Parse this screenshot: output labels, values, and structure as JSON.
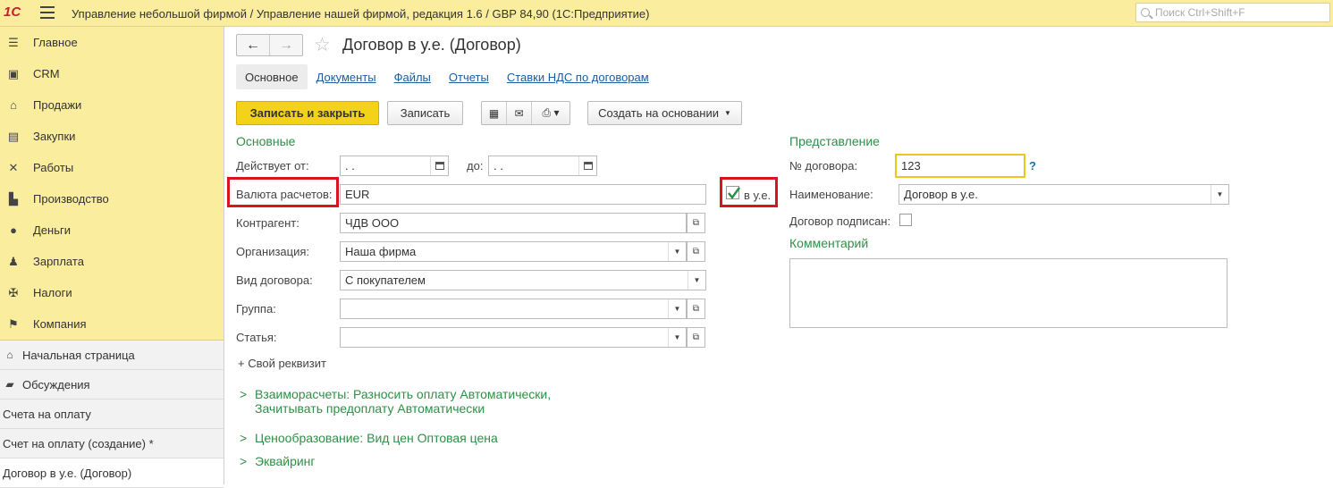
{
  "app": {
    "logo": "1С",
    "title": "Управление небольшой фирмой / Управление нашей фирмой, редакция 1.6 / GBP 84,90   (1С:Предприятие)",
    "search_placeholder": "Поиск Ctrl+Shift+F"
  },
  "sidebar": {
    "sections": [
      {
        "label": "Главное",
        "icon": "menu-icon"
      },
      {
        "label": "CRM",
        "icon": "contacts-icon"
      },
      {
        "label": "Продажи",
        "icon": "basket-icon"
      },
      {
        "label": "Закупки",
        "icon": "cart-icon"
      },
      {
        "label": "Работы",
        "icon": "tools-icon"
      },
      {
        "label": "Производство",
        "icon": "factory-icon"
      },
      {
        "label": "Деньги",
        "icon": "ruble-icon"
      },
      {
        "label": "Зарплата",
        "icon": "people-icon"
      },
      {
        "label": "Налоги",
        "icon": "eagle-icon"
      },
      {
        "label": "Компания",
        "icon": "flag-icon"
      }
    ],
    "windows": [
      {
        "label": "Начальная страница",
        "icon": "home-icon"
      },
      {
        "label": "Обсуждения",
        "icon": "chat-icon"
      },
      {
        "label": "Счета на оплату"
      },
      {
        "label": "Счет на оплату (создание) *"
      },
      {
        "label": "Договор в у.е. (Договор)"
      }
    ]
  },
  "form": {
    "title": "Договор в у.е. (Договор)",
    "tabs": [
      "Основное",
      "Документы",
      "Файлы",
      "Отчеты",
      "Ставки НДС по договорам"
    ],
    "buttons": {
      "save_close": "Записать и закрыть",
      "save": "Записать",
      "create_based": "Создать на основании"
    },
    "main_group": {
      "title": "Основные",
      "valid_from_label": "Действует от:",
      "valid_from_value": " .  .",
      "valid_to_label": "до:",
      "valid_to_value": " .  .",
      "currency_label": "Валюта расчетов:",
      "currency_value": "EUR",
      "in_cu_label": "в у.е.",
      "counterparty_label": "Контрагент:",
      "counterparty_value": "ЧДВ ООО",
      "organization_label": "Организация:",
      "organization_value": "Наша фирма",
      "contract_type_label": "Вид договора:",
      "contract_type_value": "С покупателем",
      "group_label": "Группа:",
      "group_value": "",
      "article_label": "Статья:",
      "article_value": "",
      "custom_attr": "+ Свой реквизит"
    },
    "presentation": {
      "title": "Представление",
      "number_label": "№ договора:",
      "number_value": "123",
      "help": "?",
      "name_label": "Наименование:",
      "name_value": "Договор в у.е.",
      "signed_label": "Договор подписан:",
      "comment_title": "Комментарий"
    },
    "collapsibles": {
      "settlements_line1": "Взаиморасчеты: Разносить оплату Автоматически,",
      "settlements_line2": "Зачитывать предоплату Автоматически",
      "pricing": "Ценообразование: Вид цен Оптовая цена",
      "acquiring": "Эквайринг"
    }
  },
  "colors": {
    "accent_yellow": "#fbed9e",
    "primary_button": "#f5d21a",
    "group_green": "#2f8f46",
    "highlight_red": "#d9141f",
    "focus_border": "#f0c419"
  }
}
